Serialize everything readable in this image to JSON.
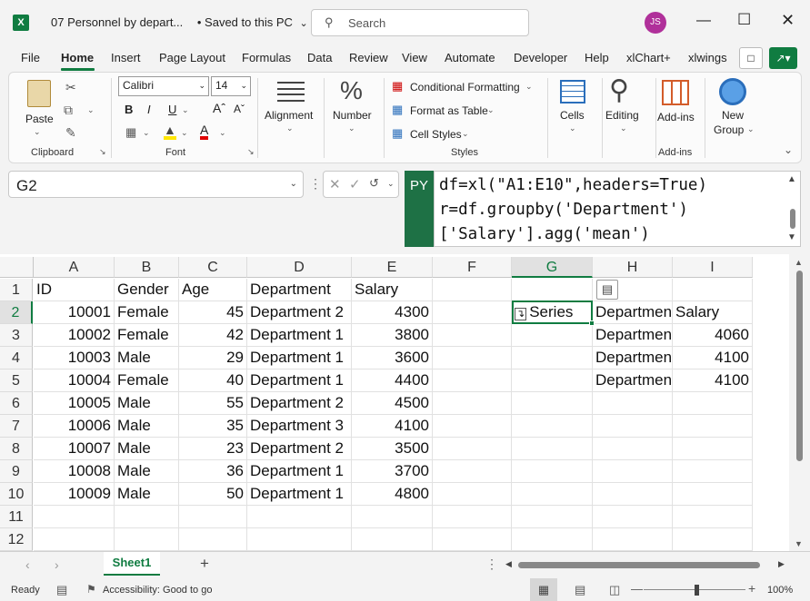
{
  "titlebar": {
    "doc_title": "07 Personnel by depart...",
    "save_status": "•  Saved to this PC",
    "search_placeholder": "Search",
    "avatar_initials": "JS",
    "app_letter": "X"
  },
  "menu": [
    "File",
    "Home",
    "Insert",
    "Page Layout",
    "Formulas",
    "Data",
    "Review",
    "View",
    "Automate",
    "Developer",
    "Help",
    "xlChart+",
    "xlwings"
  ],
  "ribbon": {
    "clipboard": {
      "paste": "Paste",
      "label": "Clipboard"
    },
    "font": {
      "name": "Calibri",
      "size": "14",
      "label": "Font"
    },
    "alignment": "Alignment",
    "number": "Number",
    "styles": {
      "conditional": "Conditional Formatting",
      "table": "Format as Table",
      "cell": "Cell Styles",
      "label": "Styles"
    },
    "cells": "Cells",
    "editing": "Editing",
    "addins": {
      "btn": "Add-ins",
      "label": "Add-ins"
    },
    "newgroup": {
      "line1": "New",
      "line2": "Group"
    }
  },
  "formula_bar": {
    "name_box": "G2",
    "py_badge": "PY",
    "formula_lines": [
      "df=xl(\"A1:E10\",headers=True)",
      "r=df.groupby('Department')",
      "['Salary'].agg('mean')"
    ]
  },
  "grid": {
    "columns": [
      "A",
      "B",
      "C",
      "D",
      "E",
      "F",
      "G",
      "H",
      "I"
    ],
    "rows": [
      "1",
      "2",
      "3",
      "4",
      "5",
      "6",
      "7",
      "8",
      "9",
      "10",
      "11",
      "12"
    ],
    "data": [
      [
        "ID",
        "Gender",
        "Age",
        "Department",
        "Salary"
      ],
      [
        "10001",
        "Female",
        "45",
        "Department 2",
        "4300"
      ],
      [
        "10002",
        "Female",
        "42",
        "Department 1",
        "3800"
      ],
      [
        "10003",
        "Male",
        "29",
        "Department 1",
        "3600"
      ],
      [
        "10004",
        "Female",
        "40",
        "Department 1",
        "4400"
      ],
      [
        "10005",
        "Male",
        "55",
        "Department 2",
        "4500"
      ],
      [
        "10006",
        "Male",
        "35",
        "Department 3",
        "4100"
      ],
      [
        "10007",
        "Male",
        "23",
        "Department 2",
        "3500"
      ],
      [
        "10008",
        "Male",
        "36",
        "Department 1",
        "3700"
      ],
      [
        "10009",
        "Male",
        "50",
        "Department 1",
        "4800"
      ]
    ],
    "g2_value": "Series",
    "spill": [
      [
        "Departmen",
        "Salary"
      ],
      [
        "Departmen",
        "4060"
      ],
      [
        "Departmen",
        "4100"
      ],
      [
        "Departmen",
        "4100"
      ]
    ]
  },
  "sheets": {
    "active": "Sheet1"
  },
  "status": {
    "ready": "Ready",
    "accessibility": "Accessibility: Good to go",
    "zoom": "100%"
  },
  "colors": {
    "excel_green": "#107c41",
    "py_green": "#1e7145",
    "avatar": "#b0309a"
  }
}
